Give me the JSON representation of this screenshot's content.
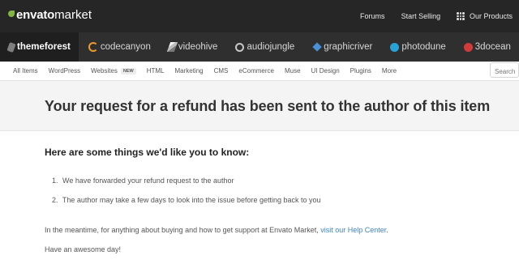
{
  "header": {
    "logo": {
      "brand_bold": "envato",
      "brand_light": "market"
    },
    "links": [
      {
        "label": "Forums"
      },
      {
        "label": "Start Selling"
      }
    ],
    "products": {
      "label": "Our Products",
      "icon": "grid-icon"
    }
  },
  "marketplaces": [
    {
      "label": "themeforest",
      "icon": "themeforest-icon",
      "active": true
    },
    {
      "label": "codecanyon",
      "icon": "codecanyon-icon"
    },
    {
      "label": "videohive",
      "icon": "videohive-icon"
    },
    {
      "label": "audiojungle",
      "icon": "audiojungle-icon"
    },
    {
      "label": "graphicriver",
      "icon": "graphicriver-icon"
    },
    {
      "label": "photodune",
      "icon": "photodune-icon"
    },
    {
      "label": "3docean",
      "icon": "3docean-icon"
    }
  ],
  "categories": [
    {
      "label": "All Items"
    },
    {
      "label": "WordPress"
    },
    {
      "label": "Websites",
      "badge": "NEW"
    },
    {
      "label": "HTML"
    },
    {
      "label": "Marketing"
    },
    {
      "label": "CMS"
    },
    {
      "label": "eCommerce"
    },
    {
      "label": "Muse"
    },
    {
      "label": "UI Design"
    },
    {
      "label": "Plugins"
    },
    {
      "label": "More"
    }
  ],
  "search": {
    "placeholder": "Search"
  },
  "banner": {
    "title": "Your request for a refund has been sent to the author of this item"
  },
  "content": {
    "heading": "Here are some things we'd like you to know:",
    "steps": [
      {
        "num": "1.",
        "text": "We have forwarded your refund request to the author"
      },
      {
        "num": "2.",
        "text": "The author may take a few days to look into the issue before getting back to you"
      }
    ],
    "meantime_text": "In the meantime, for anything about buying and how to get support at Envato Market,",
    "help_link": "visit our Help Center",
    "meantime_end": ".",
    "signoff": "Have an awesome day!"
  },
  "colors": {
    "topbar": "#262626",
    "marketbar": "#2f2f2f",
    "accent_green": "#82b541",
    "link": "#3d83c7"
  }
}
